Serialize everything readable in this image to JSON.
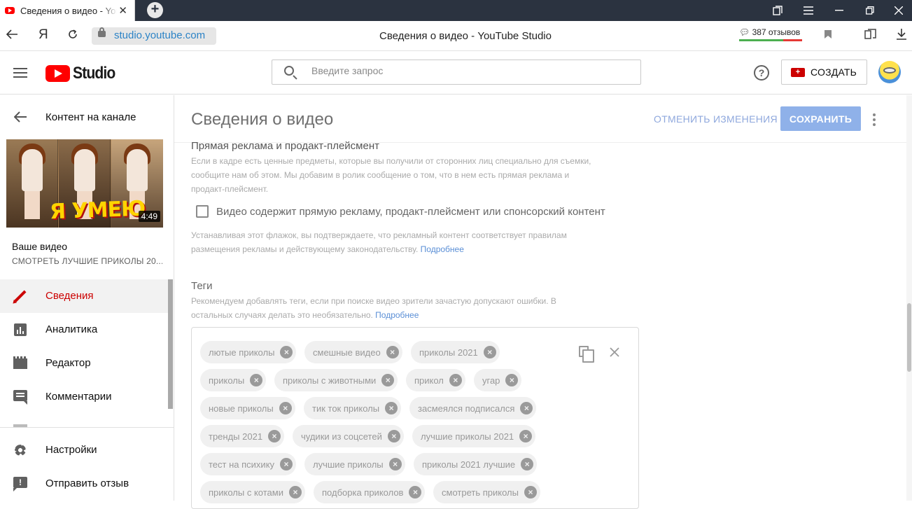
{
  "browser": {
    "tab_title": "Сведения о видео - YouTube Studio",
    "tab_close": "✕",
    "new_tab": "+",
    "url": "studio.youtube.com",
    "page_title": "Сведения о видео - YouTube Studio",
    "reviews": "387 отзывов",
    "yandex_letter": "Я"
  },
  "header": {
    "logo_text": "Studio",
    "search_placeholder": "Введите запрос",
    "help": "?",
    "create_label": "СОЗДАТЬ"
  },
  "sidebar": {
    "back_label": "Контент на канале",
    "thumbnail_banner": "Я УМЕЮ",
    "thumbnail_duration": "4:49",
    "your_video_label": "Ваше видео",
    "your_video_title": "СМОТРЕТЬ ЛУЧШИЕ ПРИКОЛЫ 20...",
    "items": [
      {
        "label": "Сведения",
        "icon": "pencil-icon",
        "active": true
      },
      {
        "label": "Аналитика",
        "icon": "analytics-icon",
        "active": false
      },
      {
        "label": "Редактор",
        "icon": "clapper-icon",
        "active": false
      },
      {
        "label": "Комментарии",
        "icon": "comment-icon",
        "active": false
      }
    ],
    "bottom_items": [
      {
        "label": "Настройки",
        "icon": "gear-icon"
      },
      {
        "label": "Отправить отзыв",
        "icon": "feedback-icon"
      }
    ]
  },
  "main": {
    "title": "Сведения о видео",
    "undo_label": "ОТМЕНИТЬ ИЗМЕНЕНИЯ",
    "save_label": "СОХРАНИТЬ",
    "ads": {
      "heading": "Прямая реклама и продакт-плейсмент",
      "description_line1": "Если в кадре есть ценные предметы, которые вы получили от сторонних лиц специально для съемки,",
      "description_line2": "сообщите нам об этом. Мы добавим в ролик сообщение о том, что в нем есть прямая реклама и",
      "description_line3": "продакт-плейсмент.",
      "checkbox_label": "Видео содержит прямую рекламу, продакт-плейсмент или спонсорский контент",
      "checkbox_checked": false,
      "note_line1": "Устанавливая этот флажок, вы подтверждаете, что рекламный контент соответствует правилам",
      "note_line2": "размещения рекламы и действующему законодательству.",
      "note_link": "Подробнее"
    },
    "tags": {
      "heading": "Теги",
      "description_line1": "Рекомендуем добавлять теги, если при поиске видео зрители зачастую допускают ошибки. В",
      "description_line2": "остальных случаях делать это необязательно.",
      "link": "Подробнее",
      "items": [
        "лютые приколы",
        "смешные видео",
        "приколы 2021",
        "приколы",
        "приколы с животными",
        "прикол",
        "угар",
        "новые приколы",
        "тик ток приколы",
        "засмеялся подписался",
        "тренды 2021",
        "чудики из соцсетей",
        "лучшие приколы 2021",
        "тест на психику",
        "лучшие приколы",
        "приколы 2021 лучшие",
        "приколы с котами",
        "подборка приколов",
        "смотреть приколы"
      ]
    }
  }
}
